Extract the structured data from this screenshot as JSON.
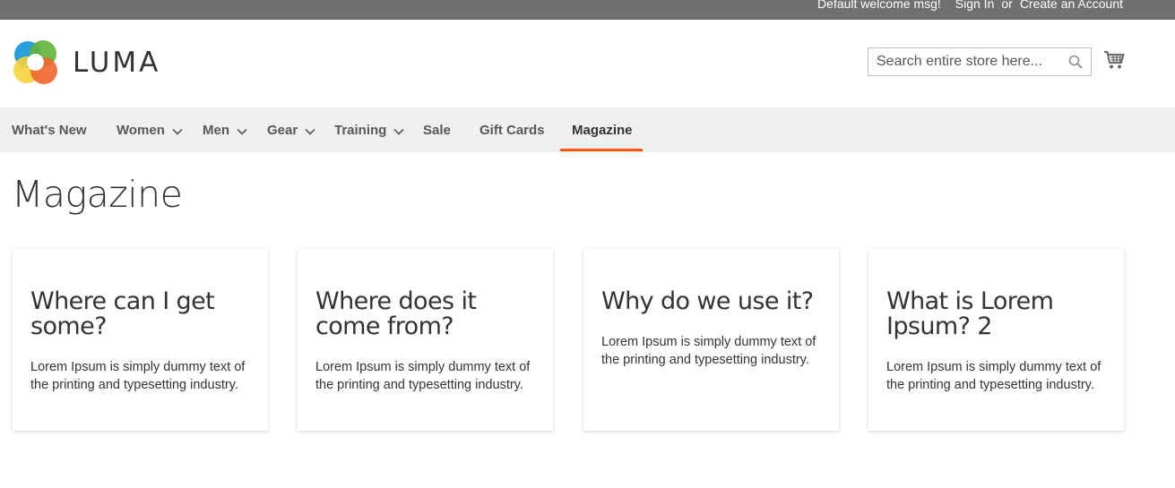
{
  "topbar": {
    "welcome": "Default welcome msg!",
    "signin": "Sign In",
    "or": "or",
    "create_account": "Create an Account"
  },
  "header": {
    "logo_text": "LUMA",
    "search_placeholder": "Search entire store here...",
    "cart_icon": "cart-icon",
    "search_icon": "search-icon"
  },
  "nav": {
    "items": [
      {
        "label": "What's New",
        "dropdown": false
      },
      {
        "label": "Women",
        "dropdown": true
      },
      {
        "label": "Men",
        "dropdown": true
      },
      {
        "label": "Gear",
        "dropdown": true
      },
      {
        "label": "Training",
        "dropdown": true
      },
      {
        "label": "Sale",
        "dropdown": false
      },
      {
        "label": "Gift Cards",
        "dropdown": false
      },
      {
        "label": "Magazine",
        "dropdown": false,
        "active": true
      }
    ],
    "active_color": "#ff5501"
  },
  "page": {
    "title": "Magazine"
  },
  "cards": [
    {
      "title": "Where can I get some?",
      "text": "Lorem Ipsum is simply dummy text of the printing and typesetting industry."
    },
    {
      "title": "Where does it come from?",
      "text": "Lorem Ipsum is simply dummy text of the printing and typesetting industry."
    },
    {
      "title": "Why do we use it?",
      "text": "Lorem Ipsum is simply dummy text of the printing and typesetting industry."
    },
    {
      "title": "What is Lorem Ipsum? 2",
      "text": "Lorem Ipsum is simply dummy text of the printing and typesetting industry."
    }
  ]
}
